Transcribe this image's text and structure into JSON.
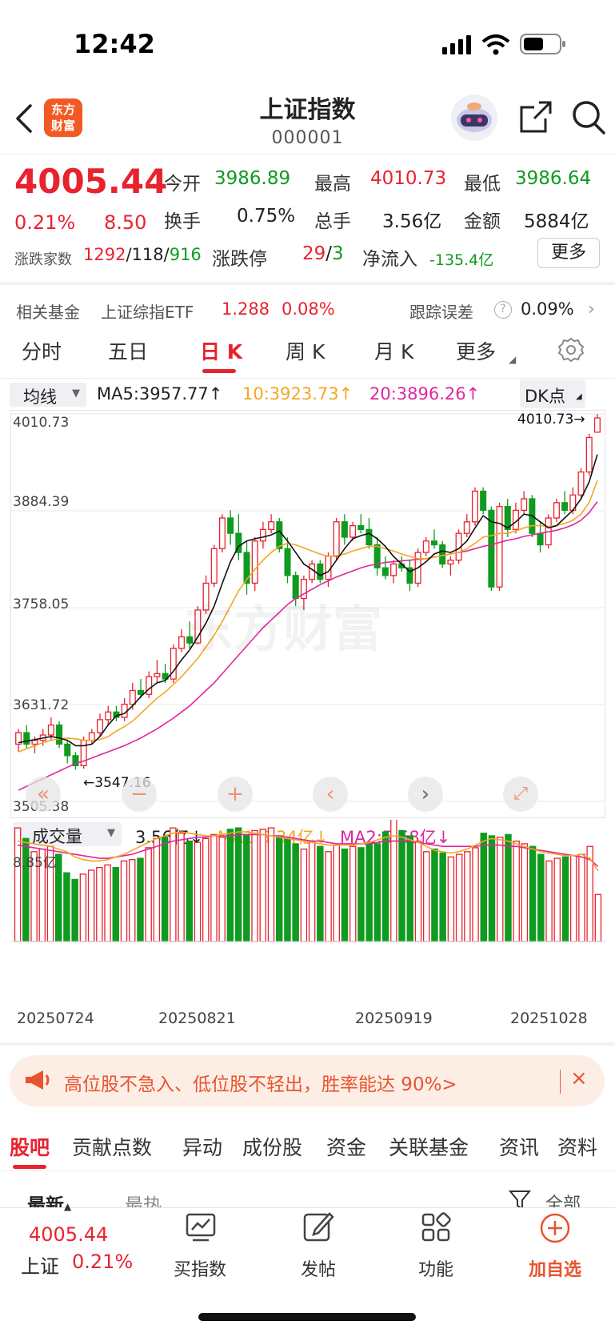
{
  "status": {
    "time": "12:42"
  },
  "nav": {
    "title": "上证指数",
    "code": "000001",
    "logo_line1": "东方",
    "logo_line2": "财富"
  },
  "quote": {
    "price": "4005.44",
    "change_pct": "0.21%",
    "change": "8.50",
    "open_label": "今开",
    "open": "3986.89",
    "high_label": "最高",
    "high": "4010.73",
    "low_label": "最低",
    "low": "3986.64",
    "turnover_label": "换手",
    "turnover": "0.75%",
    "volume_label": "总手",
    "volume": "3.56亿",
    "amount_label": "金额",
    "amount": "5884亿",
    "breadth_label": "涨跌家数",
    "up": "1292",
    "flat": "118",
    "down": "916",
    "limit_label": "涨跌停",
    "limit_up": "29",
    "limit_down": "3",
    "netflow_label": "净流入",
    "netflow": "-135.4亿",
    "more_label": "更多"
  },
  "fund": {
    "label": "相关基金",
    "name": "上证综指ETF",
    "price": "1.288",
    "pct": "0.08%",
    "track_label": "跟踪误差",
    "track_value": "0.09%"
  },
  "tabs": [
    "分时",
    "五日",
    "日 K",
    "周 K",
    "月 K",
    "更多"
  ],
  "ma_bar": {
    "selector": "均线",
    "ma5": "MA5:3957.77↑",
    "ma10": "10:3923.73↑",
    "ma20": "20:3896.26↑",
    "dk": "DK点"
  },
  "price_axis": [
    "4010.73",
    "3884.39",
    "3758.05",
    "3631.72",
    "3505.38"
  ],
  "annotations": {
    "high": "4010.73",
    "low": "3547.16"
  },
  "watermark": "东方财富",
  "volume_bar": {
    "selector": "成交量",
    "vol": "3.56亿↓",
    "ma1": "MA1:5.34亿↓",
    "ma2": "MA2:5.68亿↓",
    "axis_max": "8.85亿"
  },
  "dates": [
    "20250724",
    "20250821",
    "20250919",
    "20251028"
  ],
  "banner": {
    "text": "高位股不急入、低位股不轻出，胜率能达 90%>"
  },
  "bottom_tabs": [
    "股吧",
    "贡献点数",
    "异动",
    "成份股",
    "资金",
    "关联基金",
    "资讯",
    "资料"
  ],
  "sub_tabs": [
    "最新",
    "最热",
    "全部"
  ],
  "bottom_bar": {
    "price": "4005.44",
    "name": "上证",
    "pct": "0.21%",
    "buy": "买指数",
    "post": "发帖",
    "func": "功能",
    "add": "加自选"
  },
  "colors": {
    "up": "#e8232f",
    "down": "#0e9b1f",
    "ma5": "#111111",
    "ma10": "#f5a623",
    "ma20": "#e0269e"
  },
  "chart_data": {
    "type": "candlestick",
    "ylim": [
      3505.38,
      4010.73
    ],
    "price_ticks": [
      4010.73,
      3884.39,
      3758.05,
      3631.72,
      3505.38
    ],
    "date_ticks": [
      "20250724",
      "20250821",
      "20250919",
      "20251028"
    ],
    "ohlc": [
      [
        3580,
        3600,
        3570,
        3595
      ],
      [
        3595,
        3605,
        3575,
        3580
      ],
      [
        3580,
        3590,
        3568,
        3585
      ],
      [
        3585,
        3600,
        3578,
        3592
      ],
      [
        3592,
        3615,
        3585,
        3605
      ],
      [
        3605,
        3610,
        3575,
        3580
      ],
      [
        3580,
        3585,
        3555,
        3565
      ],
      [
        3565,
        3570,
        3547,
        3552
      ],
      [
        3552,
        3590,
        3548,
        3585
      ],
      [
        3585,
        3600,
        3580,
        3595
      ],
      [
        3595,
        3620,
        3590,
        3612
      ],
      [
        3612,
        3630,
        3605,
        3622
      ],
      [
        3622,
        3630,
        3610,
        3615
      ],
      [
        3615,
        3640,
        3610,
        3632
      ],
      [
        3632,
        3660,
        3625,
        3650
      ],
      [
        3650,
        3665,
        3640,
        3645
      ],
      [
        3645,
        3675,
        3640,
        3668
      ],
      [
        3668,
        3690,
        3660,
        3672
      ],
      [
        3672,
        3685,
        3660,
        3665
      ],
      [
        3665,
        3710,
        3660,
        3705
      ],
      [
        3705,
        3730,
        3700,
        3720
      ],
      [
        3720,
        3740,
        3705,
        3712
      ],
      [
        3712,
        3760,
        3710,
        3755
      ],
      [
        3755,
        3800,
        3750,
        3790
      ],
      [
        3790,
        3840,
        3785,
        3835
      ],
      [
        3835,
        3880,
        3830,
        3875
      ],
      [
        3875,
        3885,
        3840,
        3855
      ],
      [
        3855,
        3880,
        3820,
        3830
      ],
      [
        3830,
        3845,
        3775,
        3790
      ],
      [
        3790,
        3850,
        3780,
        3845
      ],
      [
        3845,
        3870,
        3835,
        3860
      ],
      [
        3860,
        3880,
        3855,
        3870
      ],
      [
        3870,
        3875,
        3830,
        3835
      ],
      [
        3835,
        3850,
        3790,
        3800
      ],
      [
        3800,
        3805,
        3760,
        3770
      ],
      [
        3770,
        3800,
        3755,
        3795
      ],
      [
        3795,
        3820,
        3790,
        3815
      ],
      [
        3815,
        3820,
        3790,
        3795
      ],
      [
        3795,
        3830,
        3785,
        3825
      ],
      [
        3825,
        3875,
        3820,
        3870
      ],
      [
        3870,
        3880,
        3840,
        3850
      ],
      [
        3850,
        3870,
        3845,
        3865
      ],
      [
        3865,
        3880,
        3855,
        3860
      ],
      [
        3860,
        3875,
        3835,
        3840
      ],
      [
        3840,
        3850,
        3800,
        3810
      ],
      [
        3810,
        3825,
        3795,
        3800
      ],
      [
        3800,
        3820,
        3790,
        3815
      ],
      [
        3815,
        3825,
        3805,
        3810
      ],
      [
        3810,
        3820,
        3780,
        3790
      ],
      [
        3790,
        3835,
        3785,
        3830
      ],
      [
        3830,
        3850,
        3825,
        3845
      ],
      [
        3845,
        3860,
        3835,
        3840
      ],
      [
        3840,
        3845,
        3810,
        3815
      ],
      [
        3815,
        3825,
        3800,
        3820
      ],
      [
        3820,
        3860,
        3815,
        3855
      ],
      [
        3855,
        3880,
        3850,
        3870
      ],
      [
        3870,
        3915,
        3865,
        3910
      ],
      [
        3910,
        3915,
        3880,
        3885
      ],
      [
        3885,
        3890,
        3780,
        3785
      ],
      [
        3785,
        3895,
        3780,
        3890
      ],
      [
        3890,
        3900,
        3850,
        3860
      ],
      [
        3860,
        3895,
        3855,
        3885
      ],
      [
        3885,
        3910,
        3880,
        3900
      ],
      [
        3900,
        3905,
        3850,
        3855
      ],
      [
        3855,
        3870,
        3830,
        3840
      ],
      [
        3840,
        3880,
        3835,
        3875
      ],
      [
        3875,
        3900,
        3870,
        3895
      ],
      [
        3895,
        3910,
        3880,
        3885
      ],
      [
        3885,
        3915,
        3880,
        3905
      ],
      [
        3905,
        3940,
        3900,
        3935
      ],
      [
        3935,
        3985,
        3930,
        3980
      ],
      [
        3986.89,
        4010.73,
        3986.64,
        4005.44
      ]
    ],
    "ma5": [
      3582,
      3584,
      3586,
      3588,
      3590,
      3588,
      3585,
      3578,
      3578,
      3580,
      3590,
      3605,
      3617,
      3620,
      3630,
      3642,
      3652,
      3660,
      3663,
      3675,
      3690,
      3703,
      3720,
      3738,
      3760,
      3790,
      3818,
      3838,
      3845,
      3848,
      3850,
      3853,
      3858,
      3845,
      3830,
      3815,
      3808,
      3800,
      3805,
      3820,
      3835,
      3848,
      3852,
      3855,
      3848,
      3838,
      3825,
      3815,
      3805,
      3810,
      3818,
      3828,
      3832,
      3830,
      3835,
      3845,
      3862,
      3878,
      3870,
      3868,
      3862,
      3870,
      3880,
      3878,
      3870,
      3862,
      3865,
      3875,
      3885,
      3900,
      3922,
      3957.77
    ],
    "ma10": [
      3570,
      3574,
      3578,
      3582,
      3585,
      3587,
      3588,
      3587,
      3585,
      3585,
      3586,
      3590,
      3597,
      3603,
      3610,
      3620,
      3630,
      3640,
      3648,
      3658,
      3668,
      3680,
      3692,
      3707,
      3722,
      3740,
      3760,
      3780,
      3795,
      3808,
      3820,
      3830,
      3838,
      3842,
      3840,
      3836,
      3832,
      3828,
      3825,
      3826,
      3828,
      3832,
      3835,
      3838,
      3838,
      3835,
      3832,
      3828,
      3825,
      3822,
      3822,
      3824,
      3826,
      3828,
      3830,
      3835,
      3842,
      3850,
      3852,
      3855,
      3855,
      3858,
      3862,
      3865,
      3865,
      3864,
      3865,
      3868,
      3872,
      3880,
      3895,
      3923.73
    ],
    "ma20": [
      3520,
      3525,
      3530,
      3535,
      3540,
      3545,
      3550,
      3555,
      3558,
      3562,
      3566,
      3570,
      3574,
      3578,
      3583,
      3588,
      3594,
      3600,
      3607,
      3614,
      3622,
      3630,
      3640,
      3650,
      3660,
      3672,
      3684,
      3696,
      3708,
      3720,
      3732,
      3742,
      3752,
      3762,
      3770,
      3776,
      3782,
      3788,
      3793,
      3798,
      3802,
      3806,
      3810,
      3813,
      3815,
      3817,
      3818,
      3819,
      3820,
      3821,
      3822,
      3824,
      3826,
      3828,
      3830,
      3832,
      3835,
      3838,
      3840,
      3843,
      3846,
      3848,
      3851,
      3853,
      3855,
      3857,
      3859,
      3862,
      3866,
      3872,
      3882,
      3896.26
    ],
    "volume": {
      "axis_max": 8.85,
      "values": [
        8.6,
        7.8,
        6.8,
        7.0,
        7.2,
        6.6,
        5.2,
        4.7,
        5.1,
        5.4,
        5.6,
        5.8,
        5.6,
        6.1,
        6.2,
        6.3,
        7.1,
        7.8,
        7.9,
        8.6,
        8.2,
        7.6,
        7.5,
        7.8,
        8.1,
        7.9,
        8.5,
        8.6,
        8.1,
        8.4,
        8.5,
        8.6,
        8.0,
        7.8,
        7.4,
        7.0,
        7.6,
        7.2,
        6.8,
        7.3,
        7.0,
        7.2,
        7.1,
        7.5,
        7.4,
        8.3,
        9.9,
        8.4,
        8.0,
        7.6,
        6.8,
        7.0,
        6.7,
        6.4,
        6.6,
        6.8,
        7.1,
        8.2,
        8.0,
        7.9,
        8.1,
        7.6,
        7.4,
        7.2,
        6.6,
        6.1,
        6.3,
        6.4,
        6.5,
        6.6,
        7.2,
        3.56
      ],
      "ma1": [
        7.6,
        7.5,
        7.4,
        7.3,
        7.2,
        7.0,
        6.8,
        6.4,
        6.2,
        6.1,
        6.1,
        6.2,
        6.4,
        6.6,
        6.9,
        7.2,
        7.5,
        7.8,
        8.0,
        8.2,
        8.3,
        8.2,
        8.1,
        8.0,
        8.0,
        8.1,
        8.2,
        8.3,
        8.3,
        8.2,
        8.1,
        8.0,
        7.9,
        7.8,
        7.7,
        7.6,
        7.5,
        7.4,
        7.3,
        7.3,
        7.3,
        7.3,
        7.4,
        7.5,
        7.7,
        7.9,
        8.0,
        7.9,
        7.7,
        7.5,
        7.2,
        6.9,
        6.8,
        6.7,
        6.8,
        7.0,
        7.3,
        7.6,
        7.8,
        7.7,
        7.6,
        7.4,
        7.2,
        7.0,
        6.8,
        6.7,
        6.6,
        6.5,
        6.5,
        6.6,
        6.3,
        5.34
      ],
      "ma2": [
        7.3,
        7.2,
        7.1,
        7.0,
        6.9,
        6.8,
        6.7,
        6.6,
        6.5,
        6.4,
        6.3,
        6.3,
        6.4,
        6.5,
        6.6,
        6.8,
        7.0,
        7.2,
        7.4,
        7.6,
        7.7,
        7.8,
        7.9,
        7.9,
        8.0,
        8.0,
        8.0,
        8.1,
        8.1,
        8.1,
        8.1,
        8.0,
        8.0,
        7.9,
        7.8,
        7.7,
        7.6,
        7.6,
        7.5,
        7.4,
        7.4,
        7.4,
        7.4,
        7.4,
        7.5,
        7.6,
        7.6,
        7.6,
        7.6,
        7.5,
        7.4,
        7.3,
        7.2,
        7.2,
        7.2,
        7.2,
        7.2,
        7.3,
        7.3,
        7.3,
        7.2,
        7.2,
        7.1,
        7.0,
        6.9,
        6.8,
        6.7,
        6.6,
        6.5,
        6.4,
        6.2,
        5.68
      ]
    }
  }
}
